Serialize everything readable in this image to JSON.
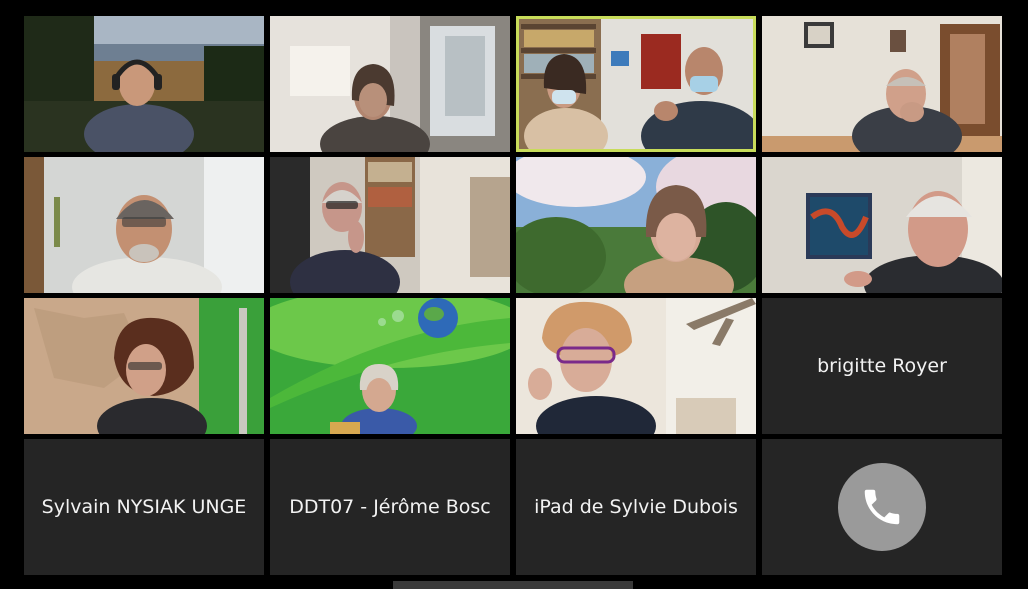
{
  "window": {
    "participants": [
      {
        "scene": "hilltop-town-headphones"
      },
      {
        "scene": "woman-by-window"
      },
      {
        "scene": "two-masked-people-bookshelf"
      },
      {
        "scene": "man-hand-on-chin-room"
      },
      {
        "scene": "man-white-shirt-glasses"
      },
      {
        "scene": "man-glasses-bookshelf"
      },
      {
        "scene": "woman-blossom-tree"
      },
      {
        "scene": "older-man-painting"
      },
      {
        "scene": "woman-curly-hair-green-wall"
      },
      {
        "scene": "woman-leaf-earth-background"
      },
      {
        "scene": "woman-glasses-ceiling-fan"
      }
    ],
    "name_tiles": {
      "brigitte": "brigitte Royer",
      "sylvain": "Sylvain NYSIAK UNGE",
      "ddt": "DDT07 - Jérôme Bosc",
      "ipad": "iPad de Sylvie Dubois"
    },
    "call_icon": "phone-icon",
    "colors": {
      "background": "#000000",
      "tile_background": "#252525",
      "active_speaker_border": "#c8dc5a",
      "call_button": "#9a9a9a"
    }
  }
}
